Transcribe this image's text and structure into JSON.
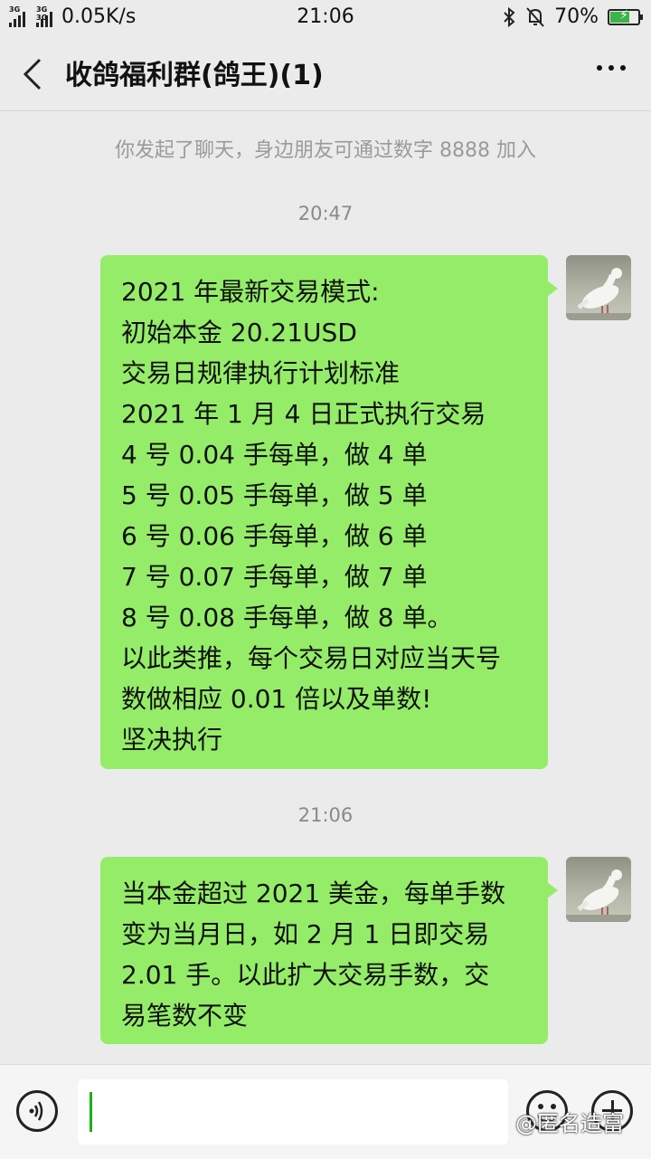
{
  "status_bar": {
    "network_1": "3G",
    "network_2": "3G 3G",
    "speed": "0.05K/s",
    "time": "21:06",
    "battery": "70%",
    "battery_level": 0.7
  },
  "header": {
    "title": "收鸽福利群(鸽王)(1)"
  },
  "chat": {
    "system_message": "你发起了聊天，身边朋友可通过数字 8888 加入",
    "timestamp_1": "20:47",
    "message_1": [
      "2021 年最新交易模式:",
      "初始本金 20.21USD",
      "交易日规律执行计划标准",
      "2021 年 1 月 4 日正式执行交易",
      "4 号 0.04 手每单，做 4 单",
      "5 号 0.05 手每单，做 5 单",
      "6 号 0.06 手每单，做 6 单",
      "7 号 0.07 手每单，做 7 单",
      "8 号 0.08 手每单，做 8 单。",
      "以此类推，每个交易日对应当天号",
      "数做相应 0.01 倍以及单数!",
      "坚决执行"
    ],
    "timestamp_2": "21:06",
    "message_2": [
      "当本金超过 2021 美金，每单手数",
      "变为当月日，如 2 月 1 日即交易",
      "2.01 手。以此扩大交易手数，交",
      "易笔数不变"
    ]
  },
  "watermark": "@匿名造富",
  "colors": {
    "bubble": "#95ec69",
    "background": "#ebebeb",
    "accent": "#1aad19"
  }
}
